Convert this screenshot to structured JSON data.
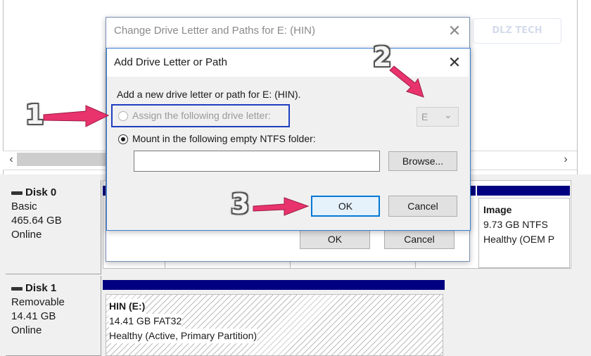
{
  "outer_dialog": {
    "title": "Change Drive Letter and Paths for E: (HIN)",
    "ok_label": "OK",
    "cancel_label": "Cancel"
  },
  "inner_dialog": {
    "title": "Add Drive Letter or Path",
    "description": "Add a new drive letter or path for E: (HIN).",
    "option_assign_label": "Assign the following drive letter:",
    "option_mount_label": "Mount in the following empty NTFS folder:",
    "drive_letter_value": "E",
    "folder_path_value": "",
    "browse_label": "Browse...",
    "ok_label": "OK",
    "cancel_label": "Cancel"
  },
  "disks": [
    {
      "name": "Disk 0",
      "type": "Basic",
      "size": "465.64 GB",
      "status": "Online"
    },
    {
      "name": "Disk 1",
      "type": "Removable",
      "size": "14.41 GB",
      "status": "Online"
    }
  ],
  "volumes": {
    "image": {
      "name": "Image",
      "size_fs": "9.73 GB NTFS",
      "status": "Healthy (OEM P"
    },
    "hin": {
      "name": "HIN  (E:)",
      "size_fs": "14.41 GB FAT32",
      "status": "Healthy (Active, Primary Partition)"
    }
  },
  "annotations": {
    "step1": "1",
    "step2": "2",
    "step3": "3",
    "arrow_color": "#e8336d"
  },
  "watermark": {
    "text": "DLZ TECH"
  },
  "icons": {
    "close": "close-icon",
    "dropdown": "chevron-down-icon",
    "scroll_left": "chevron-left-icon",
    "scroll_right": "chevron-right-icon",
    "disk": "disk-icon"
  },
  "colors": {
    "volume_header": "#000080",
    "highlight": "#1f3fbf",
    "default_button_border": "#0078d7"
  }
}
